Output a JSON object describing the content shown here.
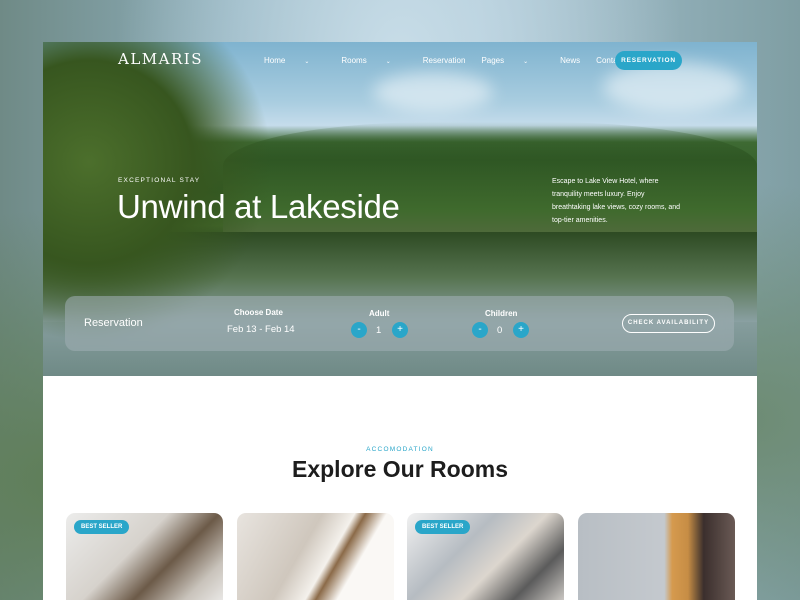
{
  "nav": {
    "logo": "ALMARIS",
    "items": [
      {
        "label": "Home",
        "dropdown": true
      },
      {
        "label": "Rooms",
        "dropdown": true
      },
      {
        "label": "Reservation",
        "dropdown": false
      },
      {
        "label": "Pages",
        "dropdown": true
      },
      {
        "label": "News",
        "dropdown": false
      },
      {
        "label": "Contact",
        "dropdown": false
      }
    ],
    "chevron": "⌄",
    "cta": "RESERVATION"
  },
  "hero": {
    "eyebrow": "EXCEPTIONAL STAY",
    "title": "Unwind at Lakeside",
    "blurb": "Escape to Lake View Hotel, where tranquility meets luxury. Enjoy breathtaking lake views, cozy rooms, and top-tier amenities."
  },
  "reservation": {
    "title": "Reservation",
    "date_label": "Choose Date",
    "date_value": "Feb 13 - Feb 14",
    "adult_label": "Adult",
    "adult_value": "1",
    "children_label": "Children",
    "children_value": "0",
    "minus": "-",
    "plus": "+",
    "check": "CHECK AVAILABILITY"
  },
  "rooms": {
    "eyebrow": "ACCOMODATION",
    "title": "Explore Our Rooms",
    "cards": [
      {
        "badge": "BEST SELLER"
      },
      {
        "badge": null
      },
      {
        "badge": "BEST SELLER"
      },
      {
        "badge": null
      }
    ]
  },
  "colors": {
    "accent": "#2aa6c9"
  }
}
